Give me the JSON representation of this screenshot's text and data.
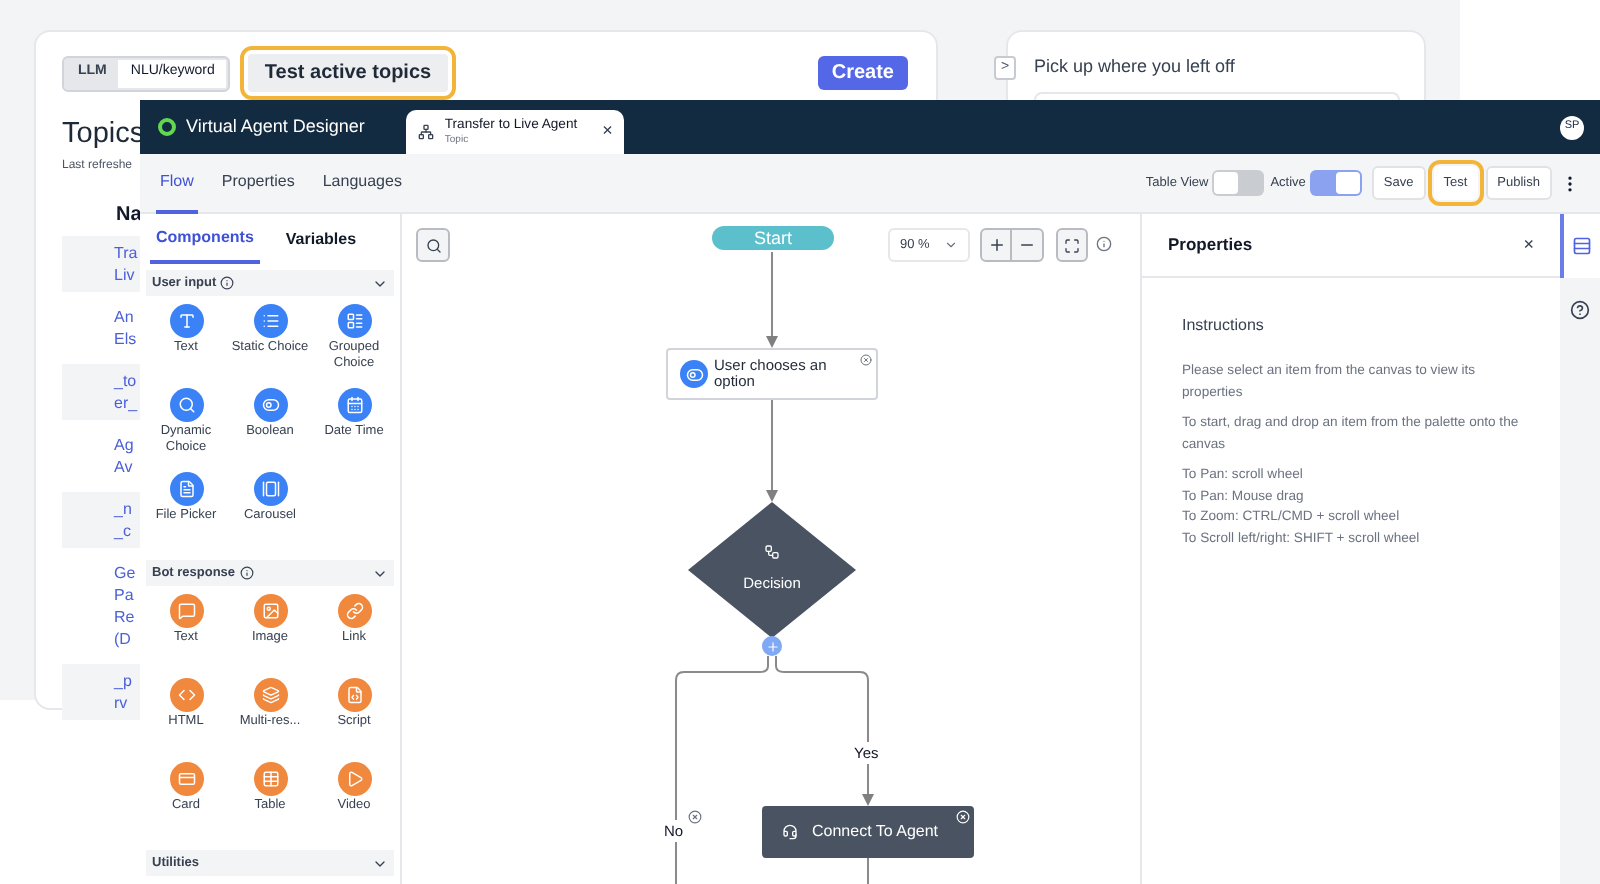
{
  "background_page": {
    "mode_toggle": [
      {
        "label": "LLM",
        "selected": true
      },
      {
        "label": "NLU/keyword",
        "selected": false
      }
    ],
    "test_button": {
      "label": "Test active topics",
      "highlighted": true
    },
    "create_button": "Create",
    "heading": "Topics",
    "refresh_note": "Last refreshe",
    "name_column": "Na",
    "rows": [
      {
        "lines": [
          "Tra",
          "Liv"
        ]
      },
      {
        "lines": [
          "An",
          "Els"
        ]
      },
      {
        "lines": [
          "_to",
          "er_"
        ]
      },
      {
        "lines": [
          "Ag",
          "Av"
        ]
      },
      {
        "lines": [
          "_n",
          "_c"
        ]
      },
      {
        "lines": [
          "Ge",
          "Pa",
          "Re",
          "(D"
        ]
      },
      {
        "lines": [
          "_p",
          "rv"
        ]
      }
    ],
    "side_card": {
      "title": "Pick up where you left off",
      "toggle": ">"
    }
  },
  "designer": {
    "app_title": "Virtual Agent Designer",
    "tab": {
      "title": "Transfer to Live Agent",
      "subtitle": "Topic",
      "close": "×"
    },
    "avatar": "SP",
    "nav_tabs": [
      {
        "label": "Flow",
        "selected": true
      },
      {
        "label": "Properties",
        "selected": false
      },
      {
        "label": "Languages",
        "selected": false
      }
    ],
    "toggles": [
      {
        "label": "Table View",
        "on": false
      },
      {
        "label": "Active",
        "on": true
      }
    ],
    "actions": [
      {
        "label": "Save",
        "highlighted": false
      },
      {
        "label": "Test",
        "highlighted": true
      },
      {
        "label": "Publish",
        "highlighted": false
      }
    ],
    "palette": {
      "tabs": [
        {
          "label": "Components",
          "selected": true
        },
        {
          "label": "Variables",
          "selected": false
        }
      ],
      "sections": [
        {
          "title": "User input",
          "info": true,
          "color": "#3b82f6",
          "items": [
            "Text",
            "Static Choice",
            "Grouped Choice",
            "Dynamic Choice",
            "Boolean",
            "Date Time",
            "File Picker",
            "Carousel"
          ]
        },
        {
          "title": "Bot response",
          "info": true,
          "color": "#f0883e",
          "items": [
            "Text",
            "Image",
            "Link",
            "HTML",
            "Multi-res...",
            "Script",
            "Card",
            "Table",
            "Video"
          ]
        },
        {
          "title": "Utilities",
          "info": false
        }
      ]
    },
    "canvas": {
      "zoom": "90 %",
      "start": "Start",
      "option_node": "User chooses an option",
      "decision": "Decision",
      "agent_node": "Connect To Agent",
      "branches": [
        "No",
        "Yes"
      ]
    },
    "properties": {
      "title": "Properties",
      "close": "×",
      "heading": "Instructions",
      "paragraphs": [
        "Please select an item from the canvas to view its properties",
        "To start, drag and drop an item from the palette onto the canvas"
      ],
      "shortcuts": [
        "To Pan: scroll wheel",
        "To Pan: Mouse drag",
        "To Zoom: CTRL/CMD + scroll wheel",
        "To Scroll left/right: SHIFT + scroll wheel"
      ]
    }
  }
}
